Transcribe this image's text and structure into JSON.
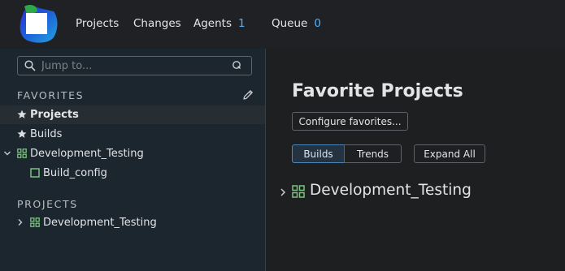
{
  "header": {
    "nav": [
      {
        "label": "Projects"
      },
      {
        "label": "Changes"
      },
      {
        "label": "Agents",
        "count": "1"
      },
      {
        "label": "Queue",
        "count": "0"
      }
    ]
  },
  "sidebar": {
    "search": {
      "placeholder": "Jump to..."
    },
    "favorites_title": "FAVORITES",
    "favorites": [
      {
        "label": "Projects",
        "icon": "star-icon",
        "selected": true
      },
      {
        "label": "Builds",
        "icon": "star-icon"
      },
      {
        "label": "Development_Testing",
        "icon": "project-icon",
        "expanded": true
      },
      {
        "label": "Build_config",
        "icon": "build-config-icon"
      }
    ],
    "projects_title": "PROJECTS",
    "projects": [
      {
        "label": "Development_Testing",
        "icon": "project-icon",
        "expanded": false
      }
    ]
  },
  "main": {
    "title": "Favorite Projects",
    "configure_label": "Configure favorites...",
    "tabs": [
      {
        "label": "Builds",
        "active": true
      },
      {
        "label": "Trends"
      }
    ],
    "expand_all_label": "Expand All",
    "projects": [
      {
        "label": "Development_Testing"
      }
    ]
  },
  "colors": {
    "accent": "#4db3ff",
    "project_icon": "#7bc47f",
    "sidebar_bg": "#1c262f",
    "page_bg": "#1e1f21"
  }
}
